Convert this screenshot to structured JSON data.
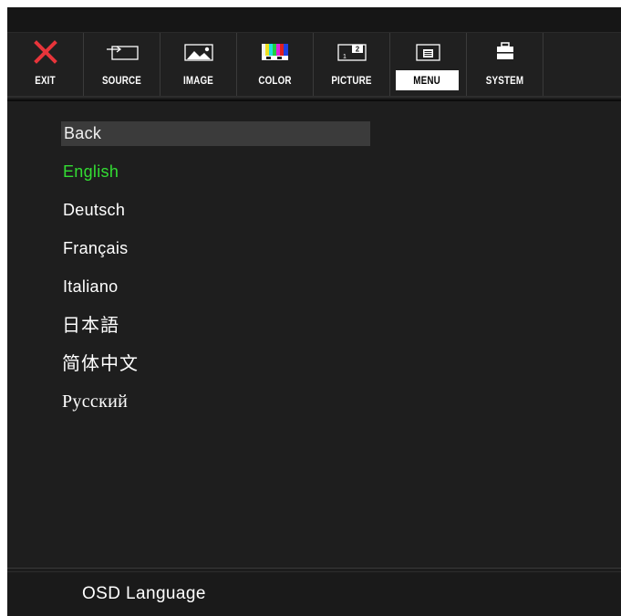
{
  "toolbar": {
    "tabs": [
      {
        "label": "EXIT",
        "icon": "close-icon"
      },
      {
        "label": "SOURCE",
        "icon": "source-input-icon"
      },
      {
        "label": "IMAGE",
        "icon": "image-icon"
      },
      {
        "label": "COLOR",
        "icon": "color-bars-icon"
      },
      {
        "label": "PICTURE",
        "icon": "picture-in-picture-icon"
      },
      {
        "label": "MENU",
        "icon": "menu-icon"
      },
      {
        "label": "SYSTEM",
        "icon": "toolbox-icon"
      }
    ],
    "active_tab": "MENU"
  },
  "menu": {
    "back": "Back",
    "languages": [
      "English",
      "Deutsch",
      "Français",
      "Italiano",
      "日本語",
      "简体中文",
      "Русский"
    ],
    "selected": "English"
  },
  "footer": {
    "title": "OSD Language"
  },
  "colors": {
    "background": "#1e1e1e",
    "selected_text": "#33dd33",
    "close_icon": "#e8343a",
    "active_tab_bg": "#ffffff"
  }
}
